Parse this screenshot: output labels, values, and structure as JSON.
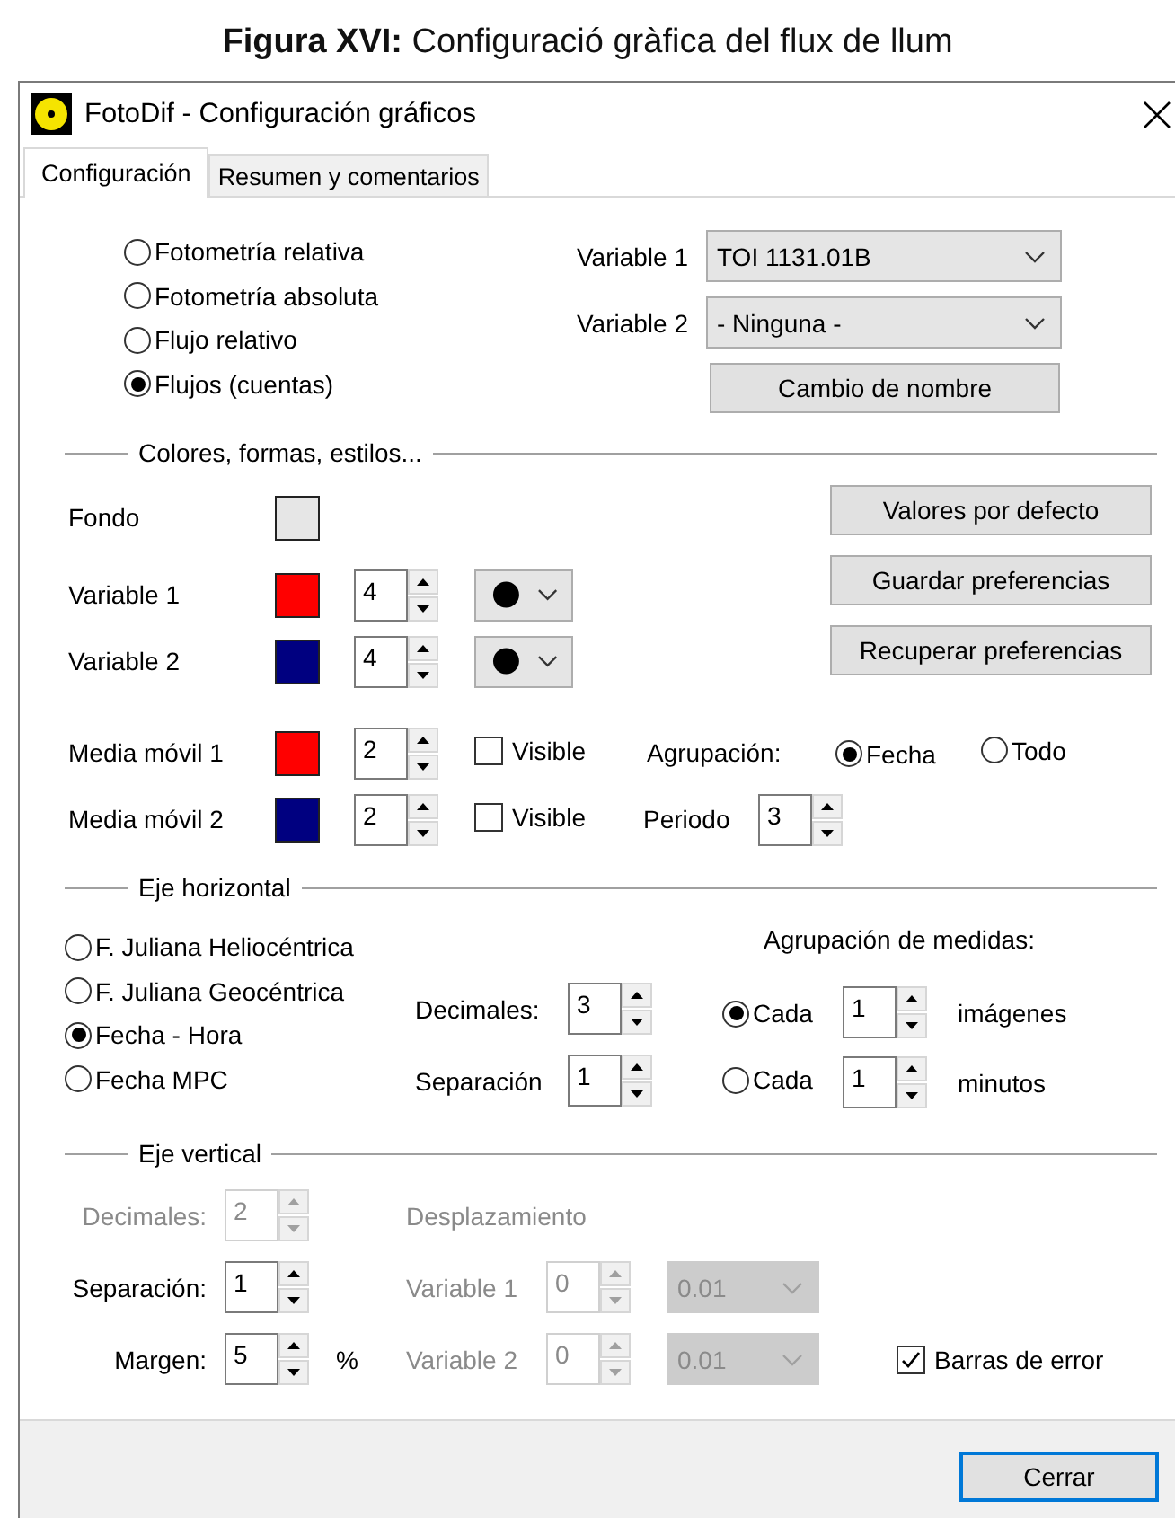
{
  "caption": "**Figura XVI:** Configuració gràfica del flux de llum",
  "window": {
    "title": "FotoDif - Configuración gráficos"
  },
  "tabs": [
    {
      "label": "Configuración",
      "selected": true
    },
    {
      "label": "Resumen y comentarios",
      "selected": false
    }
  ],
  "mode_options": [
    {
      "label": "Fotometría relativa",
      "selected": false
    },
    {
      "label": "Fotometría absoluta",
      "selected": false
    },
    {
      "label": "Flujo relativo",
      "selected": false
    },
    {
      "label": "Flujos (cuentas)",
      "selected": true
    }
  ],
  "variable_selects": [
    {
      "label": "Variable 1",
      "value": "TOI 1131.01B"
    },
    {
      "label": "Variable 2",
      "value": "- Ninguna -"
    }
  ],
  "rename_button": "Cambio de nombre",
  "styles_section": {
    "title": "Colores, formas, estilos...",
    "background": {
      "label": "Fondo",
      "color": "#e6e6e6"
    },
    "series": [
      {
        "label": "Variable 1",
        "color": "#ff0000",
        "size": "4"
      },
      {
        "label": "Variable 2",
        "color": "#000080",
        "size": "4"
      }
    ],
    "buttons": [
      "Valores por defecto",
      "Guardar preferencias",
      "Recuperar preferencias"
    ],
    "moving_averages": [
      {
        "label": "Media móvil 1",
        "color": "#ff0000",
        "value": "2",
        "visible_label": "Visible",
        "visible": false
      },
      {
        "label": "Media móvil 2",
        "color": "#000080",
        "value": "2",
        "visible_label": "Visible",
        "visible": false
      }
    ],
    "grouping": {
      "label": "Agrupación:",
      "options": [
        {
          "label": "Fecha",
          "selected": true
        },
        {
          "label": "Todo",
          "selected": false
        }
      ]
    },
    "period": {
      "label": "Periodo",
      "value": "3"
    }
  },
  "horizontal_axis": {
    "title": "Eje horizontal",
    "time_options": [
      {
        "label": "F. Juliana Heliocéntrica",
        "selected": false
      },
      {
        "label": "F. Juliana Geocéntrica",
        "selected": false
      },
      {
        "label": "Fecha - Hora",
        "selected": true
      },
      {
        "label": "Fecha MPC",
        "selected": false
      }
    ],
    "decimals": {
      "label": "Decimales:",
      "value": "3"
    },
    "separation": {
      "label": "Separación",
      "value": "1"
    },
    "grouping": {
      "title": "Agrupación de medidas:",
      "options": [
        {
          "label": "Cada",
          "value": "1",
          "unit": "imágenes",
          "selected": true
        },
        {
          "label": "Cada",
          "value": "1",
          "unit": "minutos",
          "selected": false
        }
      ]
    }
  },
  "vertical_axis": {
    "title": "Eje vertical",
    "decimals": {
      "label": "Decimales:",
      "value": "2",
      "disabled": true
    },
    "separation": {
      "label": "Separación:",
      "value": "1",
      "disabled": false
    },
    "margin": {
      "label": "Margen:",
      "value": "5",
      "unit": "%",
      "disabled": false
    },
    "offset": {
      "title": "Desplazamiento",
      "disabled": true,
      "rows": [
        {
          "label": "Variable 1",
          "value": "0",
          "step": "0.01"
        },
        {
          "label": "Variable 2",
          "value": "0",
          "step": "0.01"
        }
      ]
    },
    "error_bars": {
      "label": "Barras de error",
      "checked": true
    }
  },
  "close_button": "Cerrar"
}
